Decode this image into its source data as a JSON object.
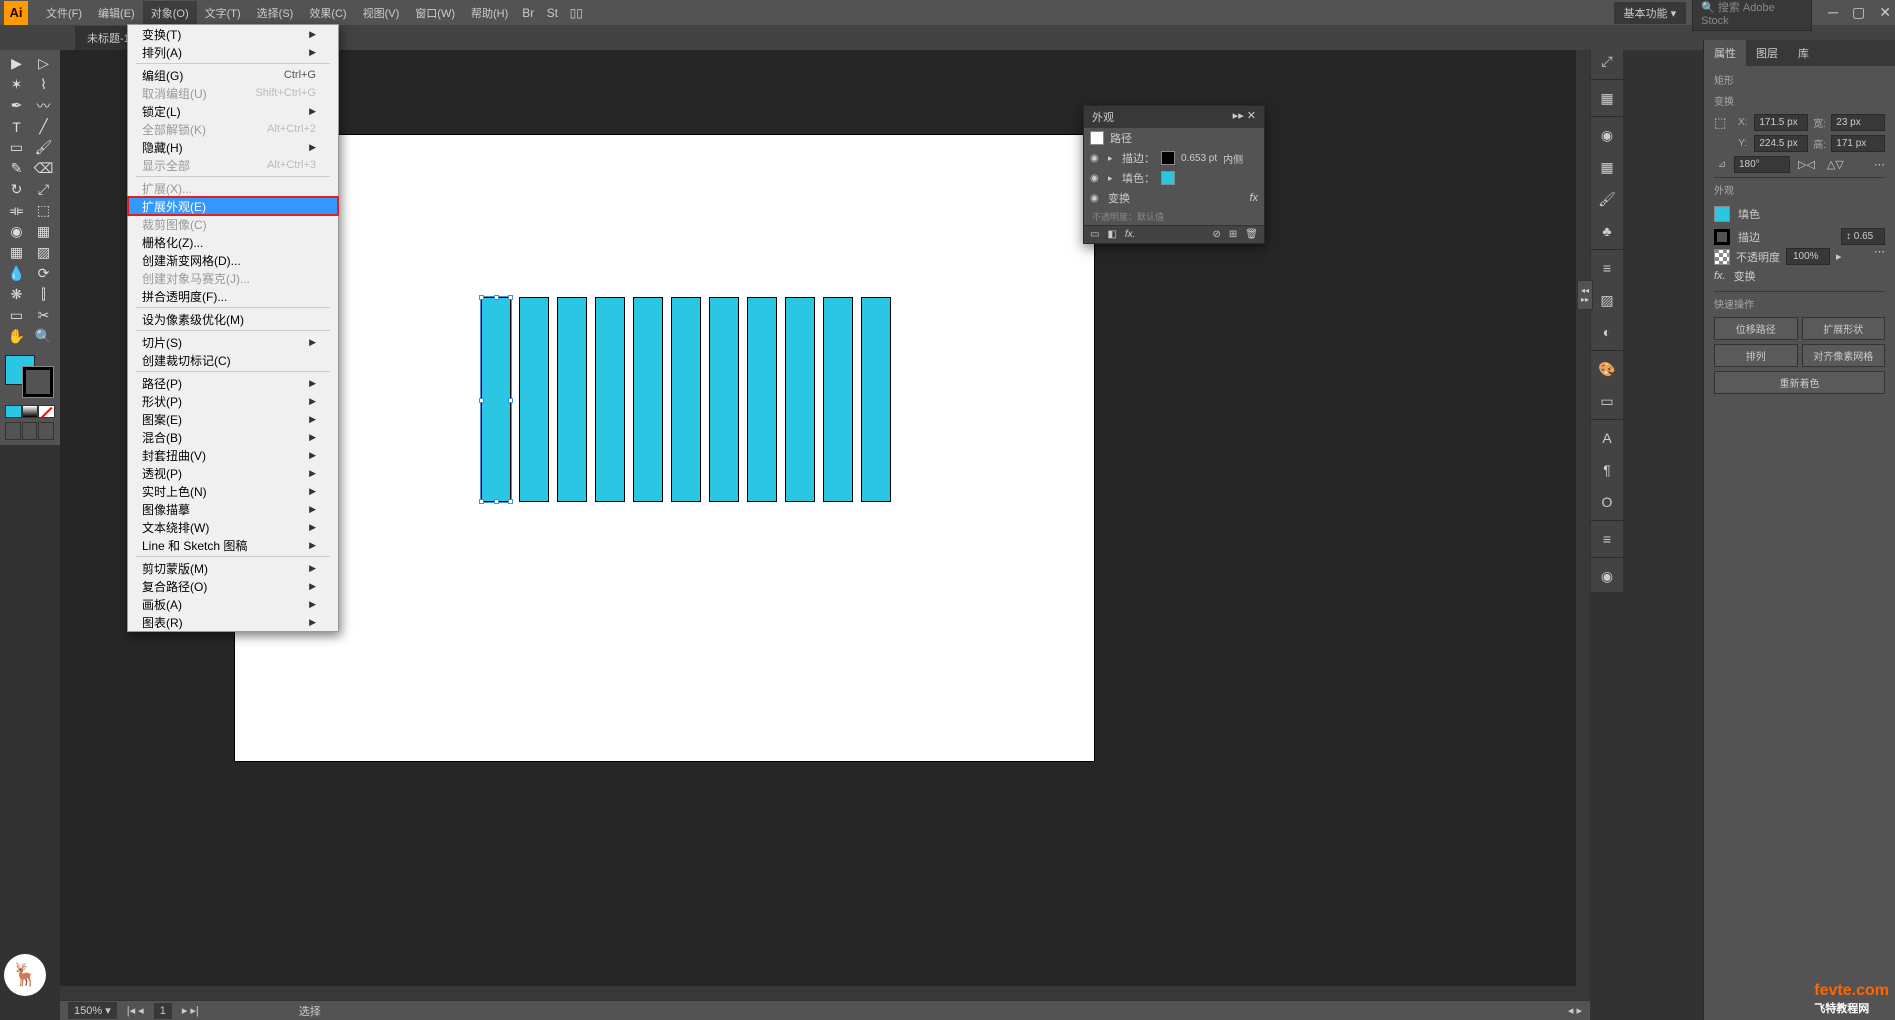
{
  "app": {
    "icon_text": "Ai"
  },
  "menubar": {
    "items": [
      "文件(F)",
      "编辑(E)",
      "对象(O)",
      "文字(T)",
      "选择(S)",
      "效果(C)",
      "视图(V)",
      "窗口(W)",
      "帮助(H)"
    ],
    "active_index": 2,
    "workspace": "基本功能",
    "search_placeholder": "搜索 Adobe Stock"
  },
  "tab": {
    "title": "未标题-1* @"
  },
  "dropdown": {
    "groups": [
      [
        {
          "label": "变换(T)",
          "arrow": true
        },
        {
          "label": "排列(A)",
          "arrow": true
        }
      ],
      [
        {
          "label": "编组(G)",
          "shortcut": "Ctrl+G"
        },
        {
          "label": "取消编组(U)",
          "shortcut": "Shift+Ctrl+G",
          "disabled": true
        },
        {
          "label": "锁定(L)",
          "arrow": true
        },
        {
          "label": "全部解锁(K)",
          "shortcut": "Alt+Ctrl+2",
          "disabled": true
        },
        {
          "label": "隐藏(H)",
          "arrow": true
        },
        {
          "label": "显示全部",
          "shortcut": "Alt+Ctrl+3",
          "disabled": true
        }
      ],
      [
        {
          "label": "扩展(X)...",
          "disabled": true
        },
        {
          "label": "扩展外观(E)",
          "highlighted": true
        },
        {
          "label": "裁剪图像(C)",
          "disabled": true
        },
        {
          "label": "栅格化(Z)...",
          "disabled": false
        },
        {
          "label": "创建渐变网格(D)...",
          "disabled": false
        },
        {
          "label": "创建对象马赛克(J)...",
          "disabled": true
        },
        {
          "label": "拼合透明度(F)...",
          "disabled": false
        }
      ],
      [
        {
          "label": "设为像素级优化(M)"
        }
      ],
      [
        {
          "label": "切片(S)",
          "arrow": true
        },
        {
          "label": "创建裁切标记(C)"
        }
      ],
      [
        {
          "label": "路径(P)",
          "arrow": true
        },
        {
          "label": "形状(P)",
          "arrow": true
        },
        {
          "label": "图案(E)",
          "arrow": true
        },
        {
          "label": "混合(B)",
          "arrow": true
        },
        {
          "label": "封套扭曲(V)",
          "arrow": true
        },
        {
          "label": "透视(P)",
          "arrow": true
        },
        {
          "label": "实时上色(N)",
          "arrow": true
        },
        {
          "label": "图像描摹",
          "arrow": true
        },
        {
          "label": "文本绕排(W)",
          "arrow": true
        },
        {
          "label": "Line 和 Sketch 图稿",
          "arrow": true
        }
      ],
      [
        {
          "label": "剪切蒙版(M)",
          "arrow": true
        },
        {
          "label": "复合路径(O)",
          "arrow": true
        },
        {
          "label": "画板(A)",
          "arrow": true
        },
        {
          "label": "图表(R)",
          "arrow": true
        }
      ]
    ]
  },
  "appearance": {
    "title": "外观",
    "path_label": "路径",
    "stroke_label": "描边：",
    "stroke_value": "0.653 pt",
    "stroke_align": "内侧",
    "fill_label": "填色：",
    "fill_color": "#2bc6e4",
    "transform_label": "变换",
    "opacity_note": "不透明度：默认值"
  },
  "properties": {
    "tabs": [
      "属性",
      "图层",
      "库"
    ],
    "shape_label": "矩形",
    "transform_label": "变换",
    "x_label": "X:",
    "x_value": "171.5 px",
    "y_label": "Y:",
    "y_value": "224.5 px",
    "w_label": "宽:",
    "w_value": "23 px",
    "h_label": "高:",
    "h_value": "171 px",
    "rotate_value": "180°",
    "appearance_section": "外观",
    "fill_label": "填色",
    "stroke_label": "描边",
    "stroke_value": "0.65",
    "opacity_label": "不透明度",
    "opacity_value": "100%",
    "fx_label": "fx.",
    "transform_effect": "变换",
    "quick_actions_label": "快速操作",
    "btn_offset": "位移路径",
    "btn_expand": "扩展形状",
    "btn_arrange": "排列",
    "btn_pixel": "对齐像素网格",
    "btn_recolor": "重新着色"
  },
  "statusbar": {
    "zoom": "150%",
    "artboard_nav": "1",
    "tool": "选择"
  },
  "canvas": {
    "rect_count": 11,
    "rect_color": "#2bc6e4"
  },
  "watermark": {
    "logo": "🦌",
    "brand": "fevte.com",
    "sub": "飞特教程网"
  }
}
